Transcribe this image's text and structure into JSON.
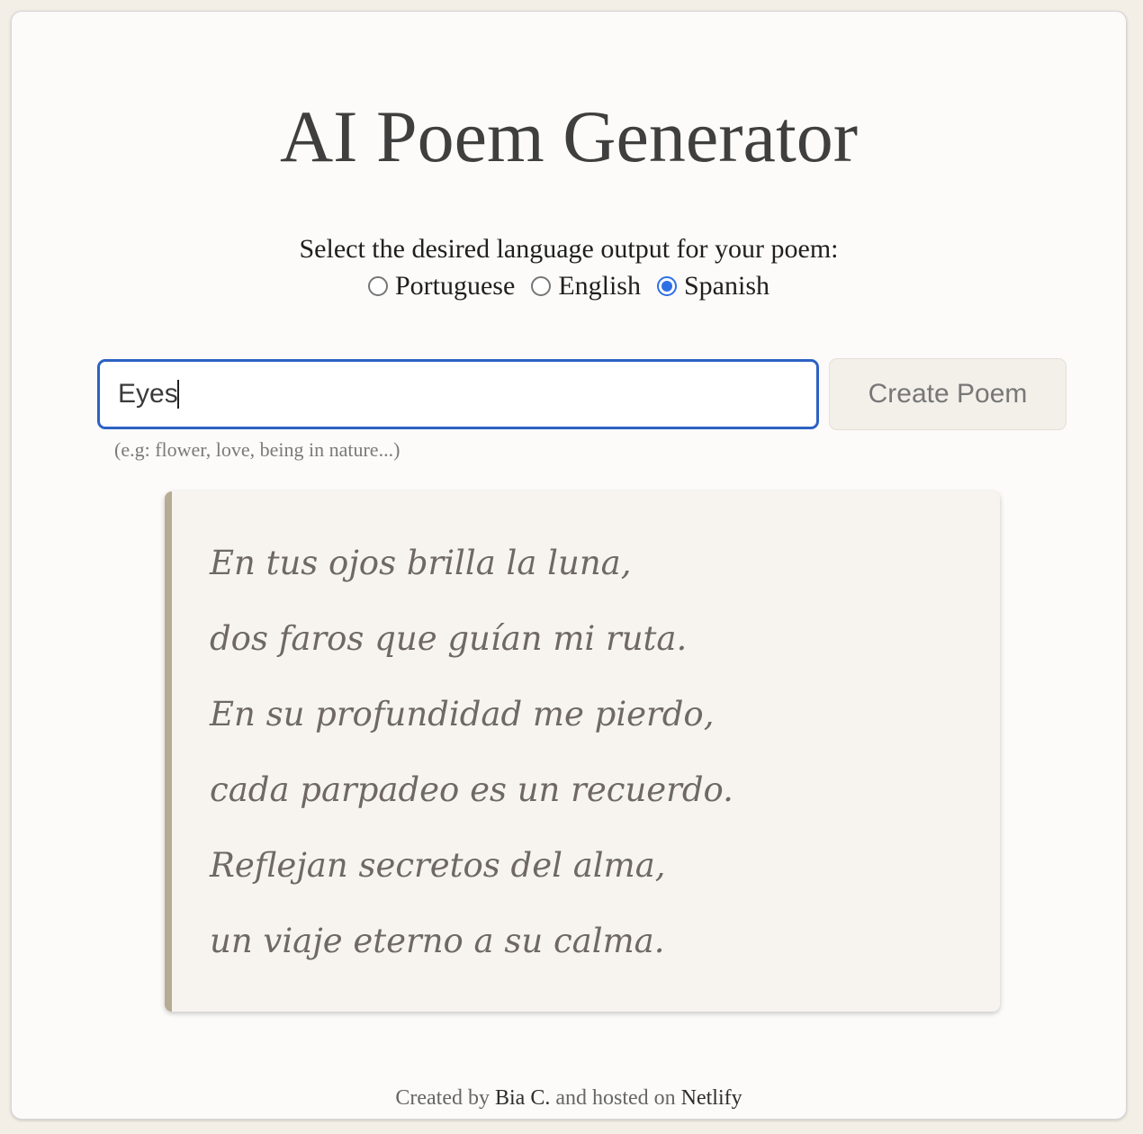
{
  "header": {
    "title": "AI Poem Generator"
  },
  "language": {
    "prompt": "Select the desired language output for your poem:",
    "options": [
      {
        "label": "Portuguese",
        "checked": false
      },
      {
        "label": "English",
        "checked": false
      },
      {
        "label": "Spanish",
        "checked": true
      }
    ]
  },
  "form": {
    "input_value": "Eyes",
    "button_label": "Create Poem",
    "hint": "(e.g: flower, love, being in nature...)"
  },
  "poem": {
    "lines": [
      "En tus ojos brilla la luna,",
      "dos faros que guían mi ruta.",
      "En su profundidad me pierdo,",
      "cada parpadeo es un recuerdo.",
      "Reflejan secretos del alma,",
      "un viaje eterno a su calma."
    ]
  },
  "footer": {
    "prefix": "Created by",
    "author": "Bia C.",
    "middle": "and hosted on",
    "host": "Netlify"
  },
  "colors": {
    "page_background": "#f4efe6",
    "card_background": "#fcfbf9",
    "input_border": "#2d62c4",
    "radio_accent": "#2f6fe5",
    "poem_accent_border": "#b8ab94",
    "poem_text": "#6f6864"
  }
}
